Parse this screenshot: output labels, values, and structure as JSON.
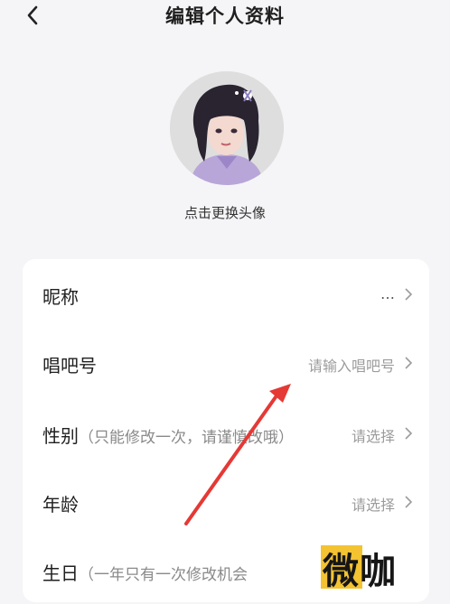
{
  "header": {
    "title": "编辑个人资料"
  },
  "avatar": {
    "caption": "点击更换头像"
  },
  "rows": [
    {
      "label": "昵称",
      "hint": "",
      "value": "…"
    },
    {
      "label": "唱吧号",
      "hint": "",
      "value": "请输入唱吧号"
    },
    {
      "label": "性别",
      "hint": "（只能修改一次，请谨慎改哦）",
      "value": "请选择"
    },
    {
      "label": "年龄",
      "hint": "",
      "value": "请选择"
    },
    {
      "label": "生日",
      "hint": "（一年只有一次修改机会",
      "value": ""
    }
  ],
  "watermark": {
    "text": "微咖"
  },
  "colors": {
    "accent": "#e53935",
    "background": "#f5f5f7",
    "placeholder": "#9c9c9c"
  }
}
